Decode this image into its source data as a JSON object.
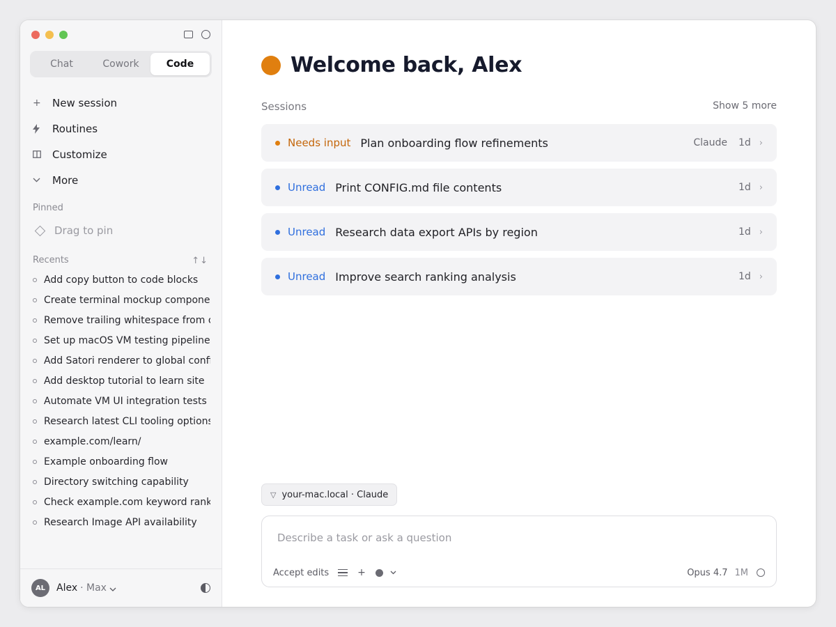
{
  "colors": {
    "traffic_close": "#ec6a5e",
    "traffic_min": "#f4bf4f",
    "traffic_max": "#61c554",
    "brand": "#e07f0f",
    "needs_input": "#c4660a",
    "unread": "#2f6fde"
  },
  "sidebar": {
    "tabs": [
      {
        "label": "Chat"
      },
      {
        "label": "Cowork"
      },
      {
        "label": "Code"
      }
    ],
    "active_tab": "Code",
    "nav": [
      {
        "icon": "plus-icon",
        "label": "New session"
      },
      {
        "icon": "bolt-icon",
        "label": "Routines"
      },
      {
        "icon": "book-icon",
        "label": "Customize"
      },
      {
        "icon": "chevron-down-icon",
        "label": "More"
      }
    ],
    "pinned_label": "Pinned",
    "pin_placeholder": "Drag to pin",
    "recents_label": "Recents",
    "recents": [
      "Add copy button to code blocks",
      "Create terminal mockup component",
      "Remove trailing whitespace from ou",
      "Set up macOS VM testing pipeline",
      "Add Satori renderer to global config",
      "Add desktop tutorial to learn site",
      "Automate VM UI integration tests",
      "Research latest CLI tooling options",
      "example.com/learn/",
      "Example onboarding flow",
      "Directory switching capability",
      "Check example.com keyword rankin",
      "Research Image API availability"
    ],
    "footer": {
      "initials": "AL",
      "name": "Alex",
      "plan": "· Max"
    }
  },
  "main": {
    "welcome": "Welcome back, Alex",
    "sessions_label": "Sessions",
    "show_more": "Show 5 more",
    "sessions": [
      {
        "status": "Needs input",
        "status_type": "needs_input",
        "title": "Plan onboarding flow refinements",
        "who": "Claude",
        "age": "1d"
      },
      {
        "status": "Unread",
        "status_type": "unread",
        "title": "Print CONFIG.md file contents",
        "who": "",
        "age": "1d"
      },
      {
        "status": "Unread",
        "status_type": "unread",
        "title": "Research data export APIs by region",
        "who": "",
        "age": "1d"
      },
      {
        "status": "Unread",
        "status_type": "unread",
        "title": "Improve search ranking analysis",
        "who": "",
        "age": "1d"
      }
    ],
    "env_chip": "your-mac.local · Claude",
    "composer": {
      "placeholder": "Describe a task or ask a question",
      "mode": "Accept edits",
      "model": "Opus 4.7",
      "context": "1M"
    }
  }
}
